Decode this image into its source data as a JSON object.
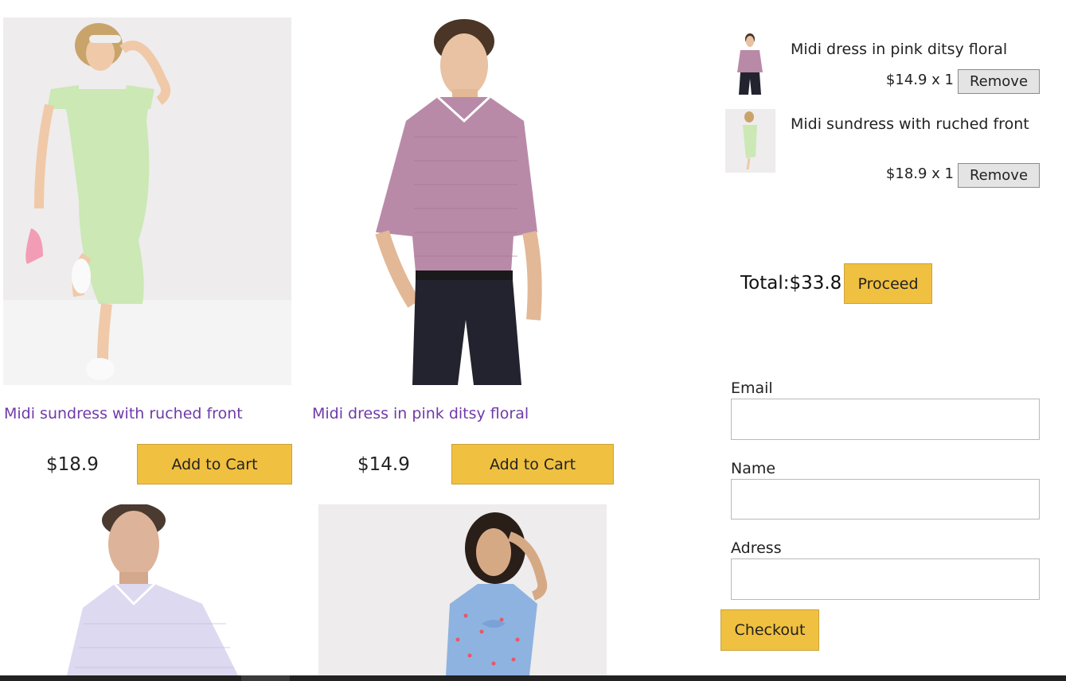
{
  "products": [
    {
      "title": "Midi sundress with ruched front",
      "price": "$18.9",
      "button": "Add to Cart",
      "image": "woman-green-dress-photo"
    },
    {
      "title": "Midi dress in pink ditsy floral",
      "price": "$14.9",
      "button": "Add to Cart",
      "image": "man-pink-shirt-photo"
    },
    {
      "image": "man-lavender-shirt-photo"
    },
    {
      "image": "woman-blue-dress-photo"
    }
  ],
  "cart": {
    "items": [
      {
        "name": "Midi dress in pink ditsy floral",
        "qty_text": "$14.9 x 1",
        "remove": "Remove"
      },
      {
        "name": "Midi sundress with ruched front",
        "qty_text": "$18.9 x 1",
        "remove": "Remove"
      }
    ],
    "total_text": "Total:$33.8",
    "proceed": "Proceed"
  },
  "checkout_form": {
    "email_label": "Email",
    "name_label": "Name",
    "address_label": "Adress",
    "email_value": "",
    "name_value": "",
    "address_value": "",
    "checkout": "Checkout"
  },
  "colors": {
    "accent_button": "#f0c040",
    "product_title": "#6f3aa8"
  }
}
